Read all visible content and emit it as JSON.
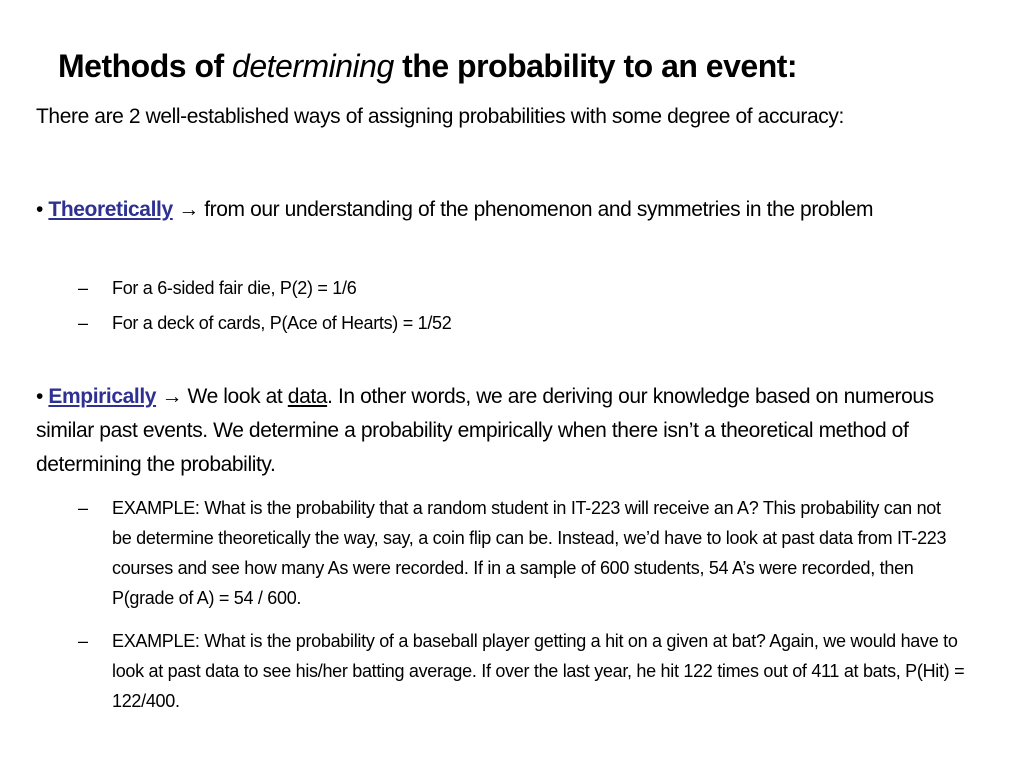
{
  "slide": {
    "title": {
      "part1": "Methods of ",
      "italic": "determining",
      "part2": " the probability to an event:"
    },
    "intro": "There are 2 well-established ways of assigning probabilities with some degree of accuracy:",
    "bullets": [
      {
        "bullet_char": "•",
        "keyword": "Theoretically",
        "arrow": "→",
        "text": " from our understanding of the phenomenon and symmetries in the problem",
        "subitems": [
          {
            "dash": "–",
            "text": "For a 6-sided fair die, P(2) = 1/6"
          },
          {
            "dash": "–",
            "text": "For a deck of cards, P(Ace of Hearts) = 1/52"
          }
        ]
      },
      {
        "bullet_char": "•",
        "keyword": "Empirically",
        "arrow": "→",
        "text_before": " We look at ",
        "underlined": "data",
        "text_after": ".  In other words, we are deriving our knowledge based on numerous similar past events. We determine a probability empirically when there isn’t a theoretical method of determining the probability.",
        "subitems": [
          {
            "dash": "–",
            "text": "EXAMPLE:  What is the probability that a random student in IT-223 will receive an A?  This probability can not be determine theoretically the way, say, a coin flip can be. Instead, we’d have to look at past data from IT-223 courses and see how many As were recorded.  If in a sample of 600 students, 54 A’s were recorded, then P(grade of A) = 54 / 600."
          },
          {
            "dash": "–",
            "text": "EXAMPLE: What is the probability of a baseball player getting a hit on a given at bat?  Again, we would have to look at past data to see his/her batting average. If over the last year, he hit 122 times out of 411 at bats, P(Hit) = 122/400."
          }
        ]
      }
    ],
    "colors": {
      "keyword": "#2E3192",
      "text": "#000000",
      "background": "#FFFFFF"
    }
  }
}
